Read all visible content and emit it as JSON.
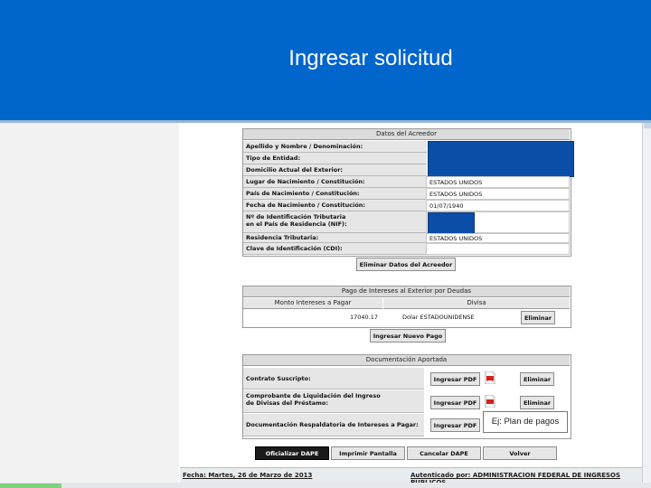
{
  "slide": {
    "title": "Ingresar solicitud"
  },
  "acreedor": {
    "header": "Datos del Acreedor",
    "rows": [
      {
        "label": "Apellido y Nombre / Denominación:",
        "value": ""
      },
      {
        "label": "Tipo de Entidad:",
        "value": ""
      },
      {
        "label": "Domicilio Actual del Exterior:",
        "value": ""
      },
      {
        "label": "Lugar de Nacimiento / Constitución:",
        "value": "ESTADOS UNIDOS"
      },
      {
        "label": "País de Nacimiento / Constitución:",
        "value": "ESTADOS UNIDOS"
      },
      {
        "label": "Fecha de Nacimiento / Constitución:",
        "value": "01/07/1940"
      },
      {
        "label_line1": "Nº de Identificación Tributaria",
        "label_line2": "en el País de Residencia (NIF):",
        "value": ""
      },
      {
        "label": "Residencia Tributaria:",
        "value": "ESTADOS UNIDOS"
      },
      {
        "label": "Clave de Identificación (CDI):",
        "value": ""
      }
    ],
    "delete_button": "Eliminar Datos del Acreedor"
  },
  "pagos": {
    "header": "Pago de Intereses al Exterior por Deudas",
    "col_monto": "Monto Intereses a Pagar",
    "col_divisa": "Divisa",
    "row": {
      "monto": "17040.17",
      "divisa": "Dolar ESTADOUNIDENSE",
      "delete": "Eliminar"
    },
    "new_button": "Ingresar Nuevo Pago"
  },
  "documentacion": {
    "header": "Documentación Aportada",
    "rows": [
      {
        "label": "Contrato Suscripto:",
        "upload": "Ingresar PDF",
        "delete": "Eliminar"
      },
      {
        "label_line1": "Comprobante de Liquidación del Ingreso",
        "label_line2": "de Divisas del Préstamo:",
        "upload": "Ingresar PDF",
        "delete": "Eliminar"
      },
      {
        "label": "Documentación Respaldatoria de Intereses a Pagar:",
        "upload": "Ingresar PDF"
      }
    ]
  },
  "tooltip": "Ej: Plan de pagos",
  "actions": {
    "oficializar": "Oficializar DAPE",
    "imprimir": "Imprimir Pantalla",
    "cancelar": "Cancelar DAPE",
    "volver": "Volver"
  },
  "status": {
    "fecha": "Fecha: Martes, 26 de Marzo de 2013",
    "autenticado": "Autenticado por: ADMINISTRACION FEDERAL DE INGRESOS PUBLICOS"
  },
  "colors": {
    "banner": "#0066cc",
    "field_highlight": "#0a4ea8"
  }
}
